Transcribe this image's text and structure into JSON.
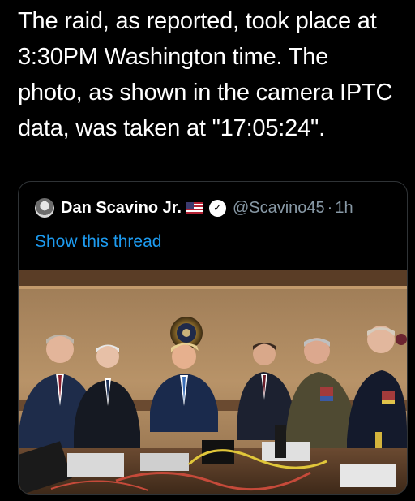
{
  "tweet": {
    "text": "The raid, as reported, took place at\n3:30PM Washington time. The\nphoto, as shown in the camera IPTC\ndata, was taken at \"17:05:24\"."
  },
  "quoted_tweet": {
    "display_name": "Dan Scavino Jr.",
    "flag_icon": "us-flag-emoji",
    "verified_icon": "verified-badge",
    "verified_glyph": "✓",
    "handle": "@Scavino45",
    "separator": "·",
    "timestamp": "1h",
    "show_thread_label": "Show this thread",
    "link_color": "#1d9bf0",
    "media": {
      "type": "photo"
    }
  }
}
